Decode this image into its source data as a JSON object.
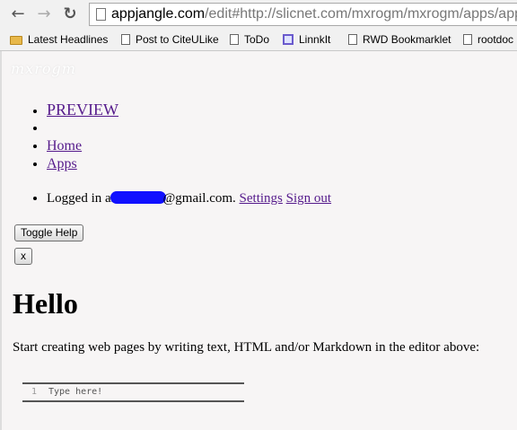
{
  "browser": {
    "back_glyph": "←",
    "forward_glyph": "→",
    "reload_glyph": "↻",
    "url_host": "appjangle.com",
    "url_rest": "/edit#http://slicnet.com/mxrogm/mxrogm/apps/apps/edit/"
  },
  "bookmarks": [
    {
      "label": "Latest Headlines",
      "icon": "folder-icon"
    },
    {
      "label": "Post to CiteULike",
      "icon": "page-icon"
    },
    {
      "label": "ToDo",
      "icon": "page-icon"
    },
    {
      "label": "LinnkIt",
      "icon": "linkit-icon"
    },
    {
      "label": "RWD Bookmarklet",
      "icon": "page-icon"
    },
    {
      "label": "rootdoc",
      "icon": "page-icon"
    }
  ],
  "page": {
    "logo_text": "mxrogm",
    "menu": {
      "preview": "PREVIEW",
      "home": "Home",
      "apps": "Apps"
    },
    "account": {
      "logged_in_prefix": "Logged in as",
      "email_suffix": "@gmail.com.",
      "settings": "Settings",
      "sign_out": "Sign out"
    },
    "toggle_help": "Toggle Help",
    "close_label": "x",
    "heading": "Hello",
    "intro": "Start creating web pages by writing text, HTML and/or Markdown in the editor above:",
    "editor": {
      "line_number": "1",
      "placeholder": "Type here!"
    }
  }
}
